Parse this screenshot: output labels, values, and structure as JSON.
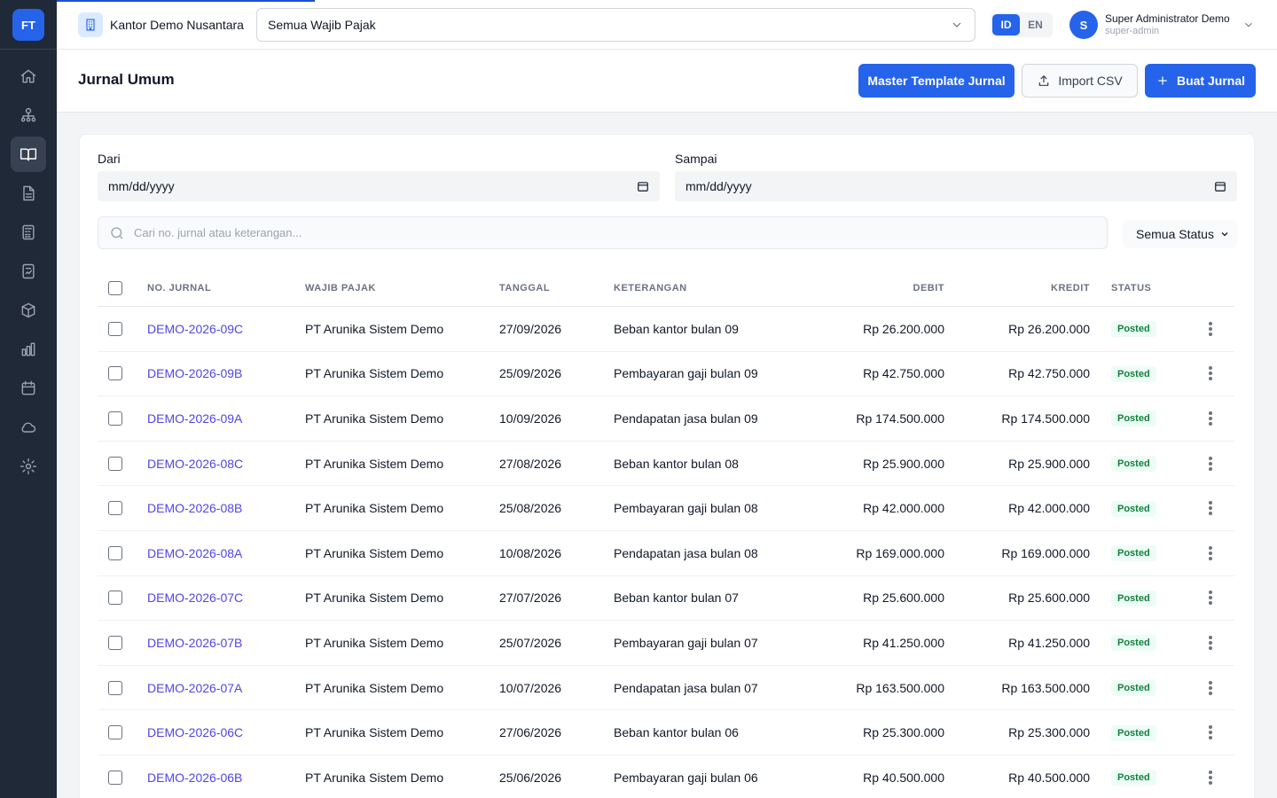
{
  "sidebar": {
    "logo": "FT",
    "items": [
      {
        "icon": "home-icon"
      },
      {
        "icon": "org-chart-icon"
      },
      {
        "icon": "book-open-icon"
      },
      {
        "icon": "document-icon"
      },
      {
        "icon": "calculator-icon"
      },
      {
        "icon": "report-icon"
      },
      {
        "icon": "box-icon"
      },
      {
        "icon": "bar-chart-icon"
      },
      {
        "icon": "calendar-icon"
      },
      {
        "icon": "cloud-icon"
      },
      {
        "icon": "gear-icon"
      }
    ]
  },
  "header": {
    "office_name": "Kantor Demo Nusantara",
    "taxpayer_select": "Semua Wajib Pajak",
    "lang_id": "ID",
    "lang_en": "EN",
    "user_initial": "S",
    "user_name": "Super Administrator Demo",
    "user_role": "super-admin"
  },
  "page": {
    "title": "Jurnal Umum",
    "btn_master": "Master Template Jurnal",
    "btn_import": "Import CSV",
    "btn_create": "Buat Jurnal"
  },
  "filters": {
    "from_label": "Dari",
    "from_value": "mm/dd/yyyy",
    "to_label": "Sampai",
    "to_value": "mm/dd/yyyy",
    "search_placeholder": "Cari no. jurnal atau keterangan...",
    "status_select": "Semua Status"
  },
  "table": {
    "headers": {
      "no": "NO. JURNAL",
      "wp": "WAJIB PAJAK",
      "tgl": "TANGGAL",
      "ket": "KETERANGAN",
      "debit": "DEBIT",
      "kredit": "KREDIT",
      "status": "STATUS"
    },
    "rows": [
      {
        "no": "DEMO-2026-09C",
        "wp": "PT Arunika Sistem Demo",
        "tgl": "27/09/2026",
        "ket": "Beban kantor bulan 09",
        "debit": "Rp 26.200.000",
        "kredit": "Rp 26.200.000",
        "status": "Posted"
      },
      {
        "no": "DEMO-2026-09B",
        "wp": "PT Arunika Sistem Demo",
        "tgl": "25/09/2026",
        "ket": "Pembayaran gaji bulan 09",
        "debit": "Rp 42.750.000",
        "kredit": "Rp 42.750.000",
        "status": "Posted"
      },
      {
        "no": "DEMO-2026-09A",
        "wp": "PT Arunika Sistem Demo",
        "tgl": "10/09/2026",
        "ket": "Pendapatan jasa bulan 09",
        "debit": "Rp 174.500.000",
        "kredit": "Rp 174.500.000",
        "status": "Posted"
      },
      {
        "no": "DEMO-2026-08C",
        "wp": "PT Arunika Sistem Demo",
        "tgl": "27/08/2026",
        "ket": "Beban kantor bulan 08",
        "debit": "Rp 25.900.000",
        "kredit": "Rp 25.900.000",
        "status": "Posted"
      },
      {
        "no": "DEMO-2026-08B",
        "wp": "PT Arunika Sistem Demo",
        "tgl": "25/08/2026",
        "ket": "Pembayaran gaji bulan 08",
        "debit": "Rp 42.000.000",
        "kredit": "Rp 42.000.000",
        "status": "Posted"
      },
      {
        "no": "DEMO-2026-08A",
        "wp": "PT Arunika Sistem Demo",
        "tgl": "10/08/2026",
        "ket": "Pendapatan jasa bulan 08",
        "debit": "Rp 169.000.000",
        "kredit": "Rp 169.000.000",
        "status": "Posted"
      },
      {
        "no": "DEMO-2026-07C",
        "wp": "PT Arunika Sistem Demo",
        "tgl": "27/07/2026",
        "ket": "Beban kantor bulan 07",
        "debit": "Rp 25.600.000",
        "kredit": "Rp 25.600.000",
        "status": "Posted"
      },
      {
        "no": "DEMO-2026-07B",
        "wp": "PT Arunika Sistem Demo",
        "tgl": "25/07/2026",
        "ket": "Pembayaran gaji bulan 07",
        "debit": "Rp 41.250.000",
        "kredit": "Rp 41.250.000",
        "status": "Posted"
      },
      {
        "no": "DEMO-2026-07A",
        "wp": "PT Arunika Sistem Demo",
        "tgl": "10/07/2026",
        "ket": "Pendapatan jasa bulan 07",
        "debit": "Rp 163.500.000",
        "kredit": "Rp 163.500.000",
        "status": "Posted"
      },
      {
        "no": "DEMO-2026-06C",
        "wp": "PT Arunika Sistem Demo",
        "tgl": "27/06/2026",
        "ket": "Beban kantor bulan 06",
        "debit": "Rp 25.300.000",
        "kredit": "Rp 25.300.000",
        "status": "Posted"
      },
      {
        "no": "DEMO-2026-06B",
        "wp": "PT Arunika Sistem Demo",
        "tgl": "25/06/2026",
        "ket": "Pembayaran gaji bulan 06",
        "debit": "Rp 40.500.000",
        "kredit": "Rp 40.500.000",
        "status": "Posted"
      }
    ]
  },
  "colors": {
    "primary": "#2563eb",
    "sidebar": "#1f2937",
    "link": "#4f46e5",
    "posted_bg": "#ecfdf5",
    "posted_text": "#15803d"
  }
}
